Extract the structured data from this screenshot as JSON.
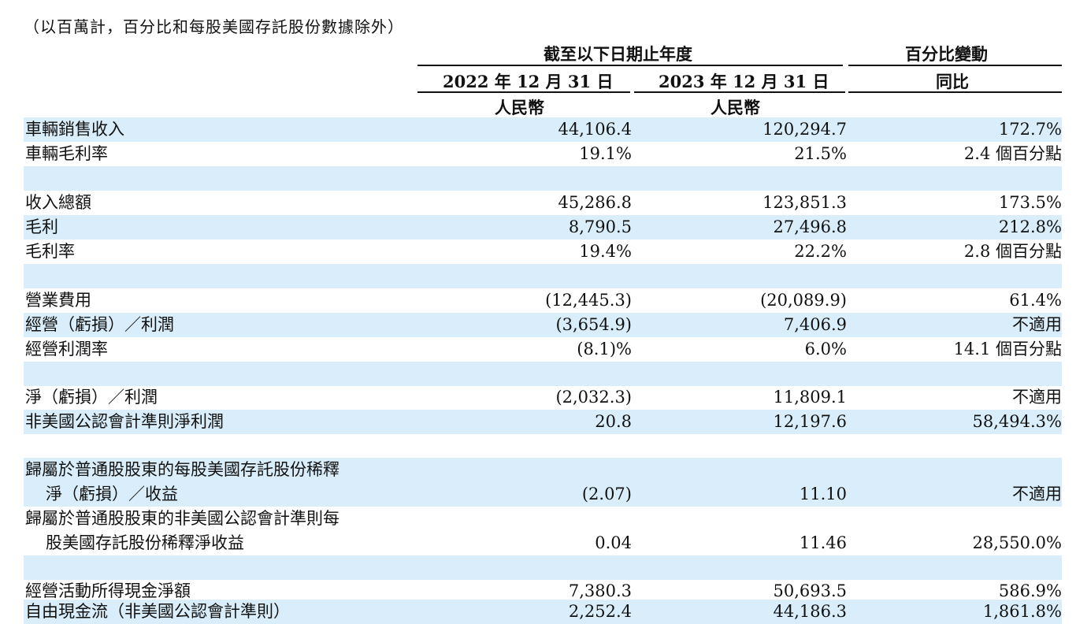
{
  "note": "（以百萬計，百分比和每股美國存託股份數據除外）",
  "header": {
    "period_group": "截至以下日期止年度",
    "change_group": "百分比變動",
    "col_2022": "2022 年 12 月 31 日",
    "col_2023": "2023 年 12 月 31 日",
    "col_change": "同比",
    "currency_2022": "人民幣",
    "currency_2023": "人民幣"
  },
  "rows": [
    {
      "label": "車輛銷售收入",
      "v2022": "44,106.4",
      "v2023": "120,294.7",
      "change": "172.7%"
    },
    {
      "label": "車輛毛利率",
      "v2022": "19.1%",
      "v2023": "21.5%",
      "change": "2.4 個百分點"
    },
    {
      "label": "收入總額",
      "v2022": "45,286.8",
      "v2023": "123,851.3",
      "change": "173.5%"
    },
    {
      "label": "毛利",
      "v2022": "8,790.5",
      "v2023": "27,496.8",
      "change": "212.8%"
    },
    {
      "label": "毛利率",
      "v2022": "19.4%",
      "v2023": "22.2%",
      "change": "2.8 個百分點"
    },
    {
      "label": "營業費用",
      "v2022": "(12,445.3)",
      "v2023": "(20,089.9)",
      "change": "61.4%"
    },
    {
      "label": "經營（虧損）／利潤",
      "v2022": "(3,654.9)",
      "v2023": "7,406.9",
      "change": "不適用"
    },
    {
      "label": "經營利潤率",
      "v2022": "(8.1)%",
      "v2023": "6.0%",
      "change": "14.1 個百分點"
    },
    {
      "label": "淨（虧損）／利潤",
      "v2022": "(2,032.3)",
      "v2023": "11,809.1",
      "change": "不適用"
    },
    {
      "label": "非美國公認會計準則淨利潤",
      "v2022": "20.8",
      "v2023": "12,197.6",
      "change": "58,494.3%"
    },
    {
      "label_line1": "歸屬於普通股股東的每股美國存託股份稀釋",
      "label_line2": "淨（虧損）／收益",
      "v2022": "(2.07)",
      "v2023": "11.10",
      "change": "不適用"
    },
    {
      "label_line1": "歸屬於普通股股東的非美國公認會計準則每",
      "label_line2": "股美國存託股份稀釋淨收益",
      "v2022": "0.04",
      "v2023": "11.46",
      "change": "28,550.0%"
    },
    {
      "label": "經營活動所得現金淨額",
      "v2022": "7,380.3",
      "v2023": "50,693.5",
      "change": "586.9%"
    },
    {
      "label": "自由現金流（非美國公認會計準則）",
      "v2022": "2,252.4",
      "v2023": "44,186.3",
      "change": "1,861.8%"
    }
  ]
}
